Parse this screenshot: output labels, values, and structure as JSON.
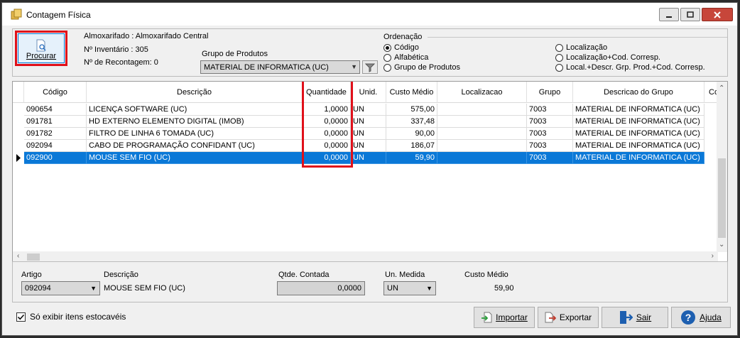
{
  "window": {
    "title": "Contagem Física"
  },
  "header": {
    "procurar_label": "Procurar",
    "almoxarifado": "Almoxarifado : Almoxarifado Central",
    "inventario": "Nº Inventário : 305",
    "recontagem": "Nº de Recontagem: 0",
    "grupo_label": "Grupo de Produtos",
    "grupo_value": "MATERIAL DE INFORMATICA (UC)"
  },
  "ordenacao": {
    "title": "Ordenação",
    "options": [
      {
        "label": "Código",
        "selected": true
      },
      {
        "label": "Alfabética",
        "selected": false
      },
      {
        "label": "Grupo de Produtos",
        "selected": false
      },
      {
        "label": "Localização",
        "selected": false
      },
      {
        "label": "Localização+Cod. Corresp.",
        "selected": false
      },
      {
        "label": "Local.+Descr. Grp. Prod.+Cod. Corresp.",
        "selected": false
      }
    ]
  },
  "grid": {
    "columns": [
      "Código",
      "Descrição",
      "Quantidade",
      "Unid.",
      "Custo Médio",
      "Localizacao",
      "Grupo",
      "Descricao do Grupo",
      "Co"
    ],
    "rows": [
      {
        "codigo": "090654",
        "descricao": "LICENÇA SOFTWARE (UC)",
        "quantidade": "1,0000",
        "unid": "UN",
        "custo": "575,00",
        "localizacao": "",
        "grupo": "7003",
        "desc_grupo": "MATERIAL DE INFORMATICA (UC)"
      },
      {
        "codigo": "091781",
        "descricao": "HD EXTERNO ELEMENTO DIGITAL (IMOB)",
        "quantidade": "0,0000",
        "unid": "UN",
        "custo": "337,48",
        "localizacao": "",
        "grupo": "7003",
        "desc_grupo": "MATERIAL DE INFORMATICA (UC)"
      },
      {
        "codigo": "091782",
        "descricao": "FILTRO DE LINHA 6 TOMADA (UC)",
        "quantidade": "0,0000",
        "unid": "UN",
        "custo": "90,00",
        "localizacao": "",
        "grupo": "7003",
        "desc_grupo": "MATERIAL DE INFORMATICA (UC)"
      },
      {
        "codigo": "092094",
        "descricao": "CABO DE PROGRAMAÇÃO CONFIDANT (UC)",
        "quantidade": "0,0000",
        "unid": "UN",
        "custo": "186,07",
        "localizacao": "",
        "grupo": "7003",
        "desc_grupo": "MATERIAL DE INFORMATICA (UC)"
      },
      {
        "codigo": "092900",
        "descricao": "MOUSE SEM FIO (UC)",
        "quantidade": "0,0000",
        "unid": "UN",
        "custo": "59,90",
        "localizacao": "",
        "grupo": "7003",
        "desc_grupo": "MATERIAL DE INFORMATICA (UC)",
        "selected": true
      }
    ]
  },
  "edit": {
    "artigo_label": "Artigo",
    "artigo_value": "092094",
    "descricao_label": "Descrição",
    "descricao_value": "MOUSE SEM FIO (UC)",
    "qtde_label": "Qtde. Contada",
    "qtde_value": "0,0000",
    "unmedida_label": "Un. Medida",
    "unmedida_value": "UN",
    "custo_label": "Custo Médio",
    "custo_value": "59,90"
  },
  "footer": {
    "checkbox_label": "Só exibir itens estocavéis",
    "checkbox_checked": true,
    "importar": "Importar",
    "exportar": "Exportar",
    "sair": "Sair",
    "ajuda": "Ajuda"
  },
  "colors": {
    "selection": "#0a78d7",
    "highlight_red": "#e0101a"
  }
}
